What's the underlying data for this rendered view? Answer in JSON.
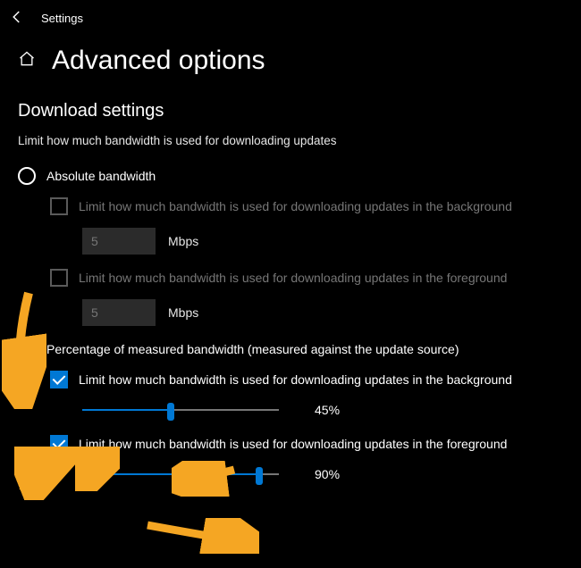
{
  "window_title": "Settings",
  "page_title": "Advanced options",
  "section": {
    "heading": "Download settings",
    "description": "Limit how much bandwidth is used for downloading updates"
  },
  "absolute": {
    "label": "Absolute bandwidth",
    "bg_check_label": "Limit how much bandwidth is used for downloading updates in the background",
    "bg_value": "5",
    "bg_unit": "Mbps",
    "fg_check_label": "Limit how much bandwidth is used for downloading updates in the foreground",
    "fg_value": "5",
    "fg_unit": "Mbps"
  },
  "percentage": {
    "label": "Percentage of measured bandwidth (measured against the update source)",
    "bg_check_label": "Limit how much bandwidth is used for downloading updates in the background",
    "bg_percent": "45%",
    "bg_fill": "45",
    "fg_check_label": "Limit how much bandwidth is used for downloading updates in the foreground",
    "fg_percent": "90%",
    "fg_fill": "90"
  }
}
